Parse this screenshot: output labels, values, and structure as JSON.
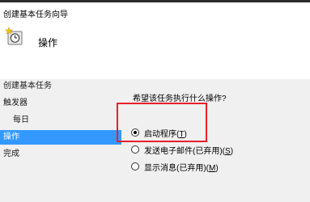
{
  "window": {
    "title": "创建基本任务向导"
  },
  "header": {
    "heading": "操作",
    "icon": "task-clock-icon"
  },
  "sidebar": {
    "items": [
      {
        "label": "创建基本任务"
      },
      {
        "label": "触发器"
      },
      {
        "label": "每日"
      },
      {
        "label": "操作"
      },
      {
        "label": "完成"
      }
    ]
  },
  "main": {
    "question": "希望该任务执行什么操作?",
    "options": [
      {
        "label": "启动程序",
        "accel": "(T)",
        "accel_key": "T",
        "checked": true
      },
      {
        "label": "发送电子邮件(已弃用)",
        "accel": "(S)",
        "accel_key": "S",
        "checked": false
      },
      {
        "label": "显示消息(已弃用)",
        "accel": "(M)",
        "accel_key": "M",
        "checked": false
      }
    ]
  },
  "colors": {
    "selection": "#3399ff",
    "highlight_border": "#e8202a",
    "header_bg": "#ffffff",
    "body_bg": "#f0f0f0"
  }
}
